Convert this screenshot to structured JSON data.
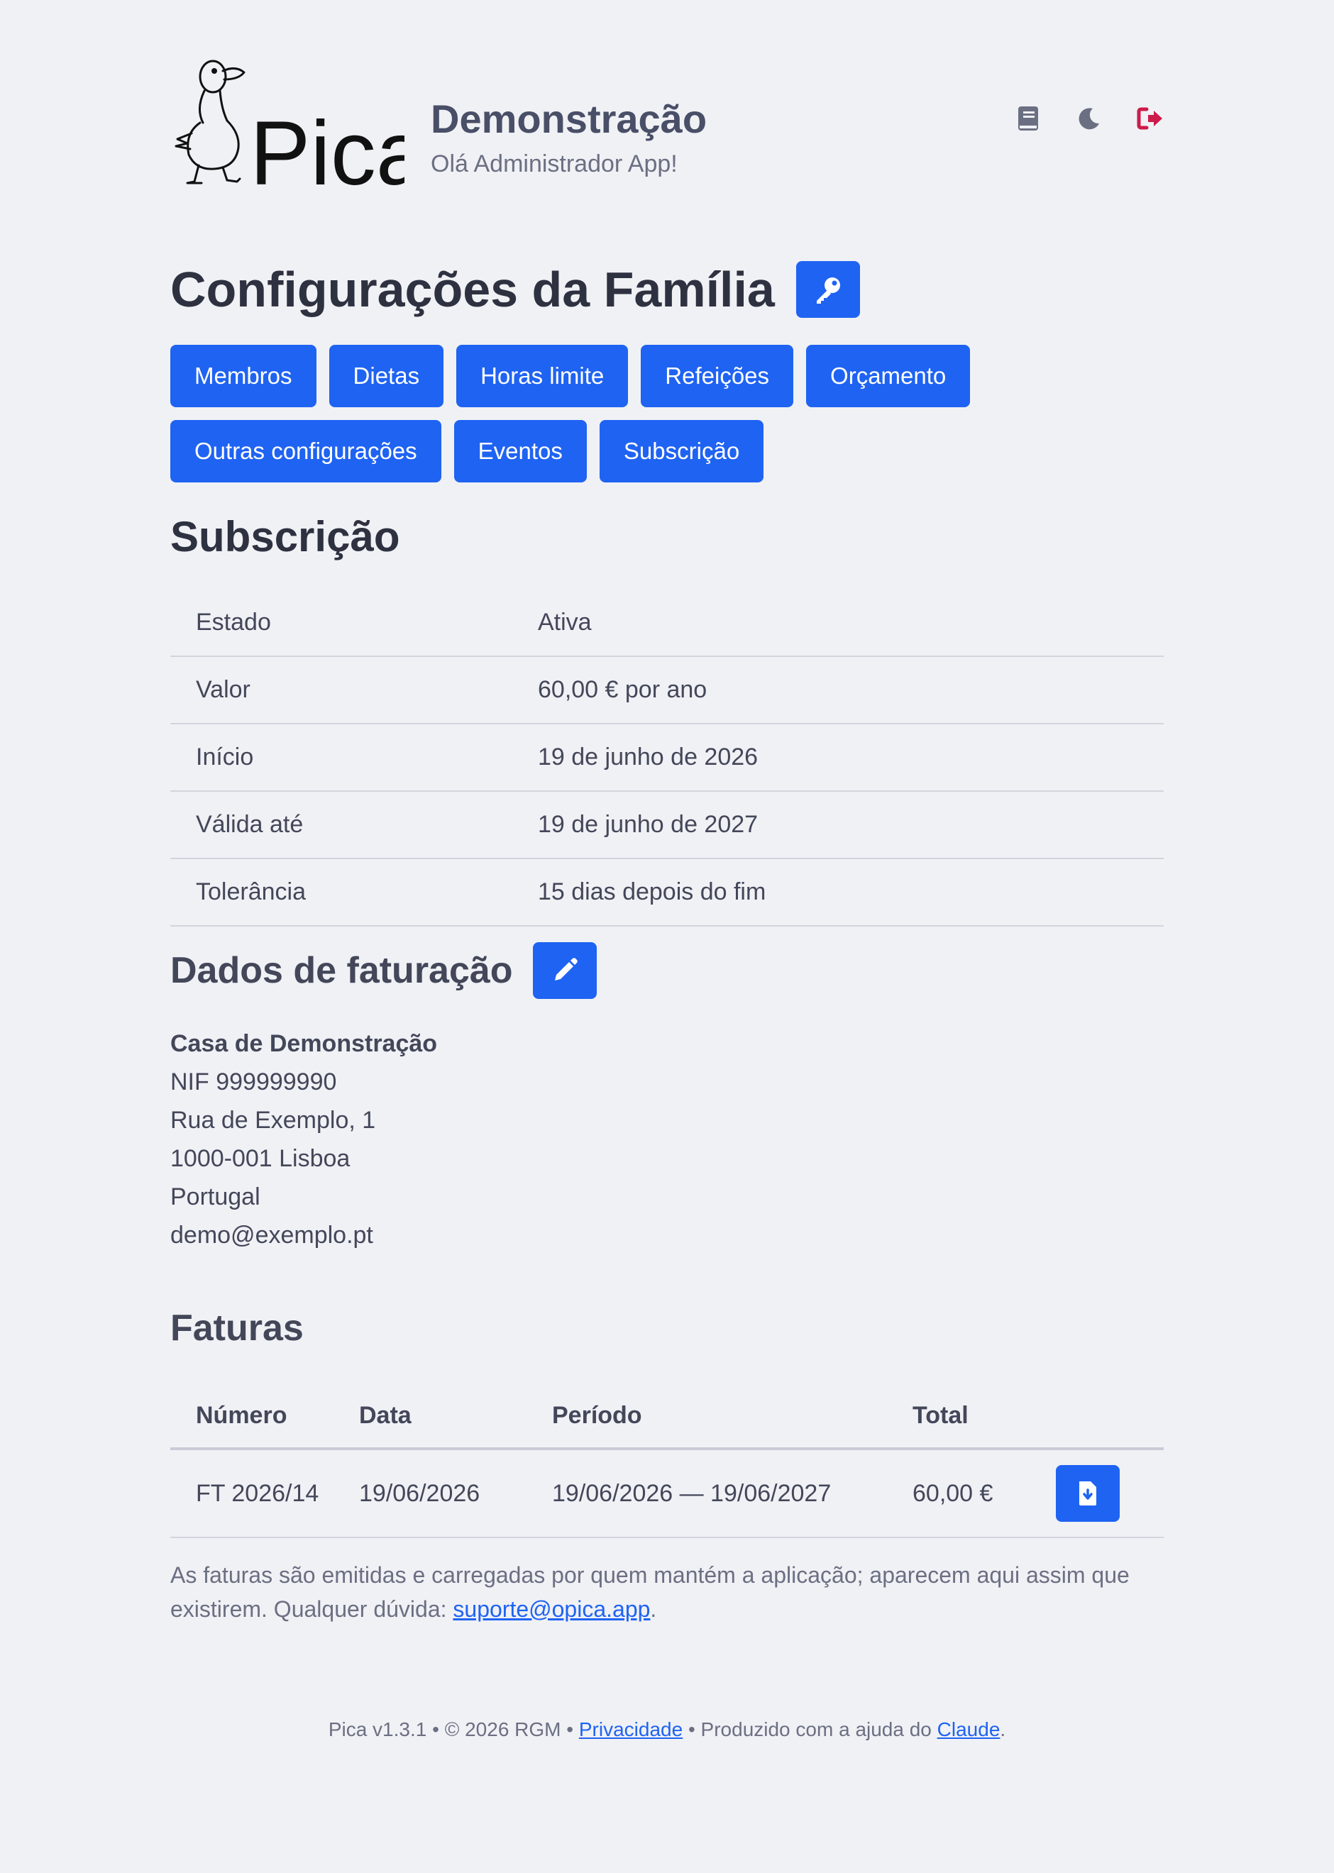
{
  "header": {
    "logo_text": "Pica",
    "title": "Demonstração",
    "greeting": "Olá Administrador App!",
    "icons": [
      "book-icon",
      "moon-icon",
      "logout-icon"
    ]
  },
  "page": {
    "title": "Configurações da Família"
  },
  "tabs": {
    "row1": [
      "Membros",
      "Dietas",
      "Horas limite",
      "Refeições",
      "Orçamento"
    ],
    "row2": [
      "Outras configurações",
      "Eventos",
      "Subscrição"
    ]
  },
  "subscription": {
    "title": "Subscrição",
    "rows": [
      {
        "label": "Estado",
        "value": "Ativa"
      },
      {
        "label": "Valor",
        "value": "60,00 € por ano"
      },
      {
        "label": "Início",
        "value": "19 de junho de 2026"
      },
      {
        "label": "Válida até",
        "value": "19 de junho de 2027"
      },
      {
        "label": "Tolerância",
        "value": "15 dias depois do fim"
      }
    ]
  },
  "billing": {
    "title": "Dados de faturação",
    "name": "Casa de Demonstração",
    "nif": "NIF 999999990",
    "street": "Rua de Exemplo, 1",
    "city": "1000-001 Lisboa",
    "country": "Portugal",
    "email": "demo@exemplo.pt"
  },
  "invoices": {
    "title": "Faturas",
    "headers": {
      "number": "Número",
      "date": "Data",
      "period": "Período",
      "total": "Total"
    },
    "rows": [
      {
        "number": "FT 2026/14",
        "date": "19/06/2026",
        "period": "19/06/2026 — 19/06/2027",
        "total": "60,00 €"
      }
    ],
    "note_text": "As faturas são emitidas e carregadas por quem mantém a aplicação; aparecem aqui assim que existirem. Qualquer dúvida: ",
    "note_link": "suporte@opica.app",
    "note_end": "."
  },
  "footer": {
    "text1": "Pica v1.3.1 • © 2026 RGM • ",
    "privacy": "Privacidade",
    "text2": " • Produzido com a ajuda do ",
    "claude": "Claude",
    "text3": "."
  },
  "colors": {
    "accent": "#1f63f2",
    "logout": "#cc1b4a",
    "background": "#f0f1f5"
  }
}
